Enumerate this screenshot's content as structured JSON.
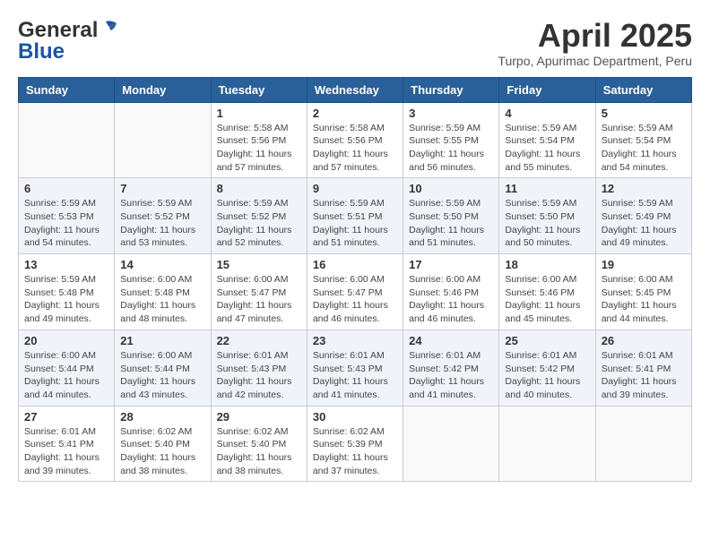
{
  "header": {
    "logo_line1": "General",
    "logo_line2": "Blue",
    "month": "April 2025",
    "location": "Turpo, Apurimac Department, Peru"
  },
  "weekdays": [
    "Sunday",
    "Monday",
    "Tuesday",
    "Wednesday",
    "Thursday",
    "Friday",
    "Saturday"
  ],
  "weeks": [
    [
      {
        "day": "",
        "info": ""
      },
      {
        "day": "",
        "info": ""
      },
      {
        "day": "1",
        "info": "Sunrise: 5:58 AM\nSunset: 5:56 PM\nDaylight: 11 hours and 57 minutes."
      },
      {
        "day": "2",
        "info": "Sunrise: 5:58 AM\nSunset: 5:56 PM\nDaylight: 11 hours and 57 minutes."
      },
      {
        "day": "3",
        "info": "Sunrise: 5:59 AM\nSunset: 5:55 PM\nDaylight: 11 hours and 56 minutes."
      },
      {
        "day": "4",
        "info": "Sunrise: 5:59 AM\nSunset: 5:54 PM\nDaylight: 11 hours and 55 minutes."
      },
      {
        "day": "5",
        "info": "Sunrise: 5:59 AM\nSunset: 5:54 PM\nDaylight: 11 hours and 54 minutes."
      }
    ],
    [
      {
        "day": "6",
        "info": "Sunrise: 5:59 AM\nSunset: 5:53 PM\nDaylight: 11 hours and 54 minutes."
      },
      {
        "day": "7",
        "info": "Sunrise: 5:59 AM\nSunset: 5:52 PM\nDaylight: 11 hours and 53 minutes."
      },
      {
        "day": "8",
        "info": "Sunrise: 5:59 AM\nSunset: 5:52 PM\nDaylight: 11 hours and 52 minutes."
      },
      {
        "day": "9",
        "info": "Sunrise: 5:59 AM\nSunset: 5:51 PM\nDaylight: 11 hours and 51 minutes."
      },
      {
        "day": "10",
        "info": "Sunrise: 5:59 AM\nSunset: 5:50 PM\nDaylight: 11 hours and 51 minutes."
      },
      {
        "day": "11",
        "info": "Sunrise: 5:59 AM\nSunset: 5:50 PM\nDaylight: 11 hours and 50 minutes."
      },
      {
        "day": "12",
        "info": "Sunrise: 5:59 AM\nSunset: 5:49 PM\nDaylight: 11 hours and 49 minutes."
      }
    ],
    [
      {
        "day": "13",
        "info": "Sunrise: 5:59 AM\nSunset: 5:48 PM\nDaylight: 11 hours and 49 minutes."
      },
      {
        "day": "14",
        "info": "Sunrise: 6:00 AM\nSunset: 5:48 PM\nDaylight: 11 hours and 48 minutes."
      },
      {
        "day": "15",
        "info": "Sunrise: 6:00 AM\nSunset: 5:47 PM\nDaylight: 11 hours and 47 minutes."
      },
      {
        "day": "16",
        "info": "Sunrise: 6:00 AM\nSunset: 5:47 PM\nDaylight: 11 hours and 46 minutes."
      },
      {
        "day": "17",
        "info": "Sunrise: 6:00 AM\nSunset: 5:46 PM\nDaylight: 11 hours and 46 minutes."
      },
      {
        "day": "18",
        "info": "Sunrise: 6:00 AM\nSunset: 5:46 PM\nDaylight: 11 hours and 45 minutes."
      },
      {
        "day": "19",
        "info": "Sunrise: 6:00 AM\nSunset: 5:45 PM\nDaylight: 11 hours and 44 minutes."
      }
    ],
    [
      {
        "day": "20",
        "info": "Sunrise: 6:00 AM\nSunset: 5:44 PM\nDaylight: 11 hours and 44 minutes."
      },
      {
        "day": "21",
        "info": "Sunrise: 6:00 AM\nSunset: 5:44 PM\nDaylight: 11 hours and 43 minutes."
      },
      {
        "day": "22",
        "info": "Sunrise: 6:01 AM\nSunset: 5:43 PM\nDaylight: 11 hours and 42 minutes."
      },
      {
        "day": "23",
        "info": "Sunrise: 6:01 AM\nSunset: 5:43 PM\nDaylight: 11 hours and 41 minutes."
      },
      {
        "day": "24",
        "info": "Sunrise: 6:01 AM\nSunset: 5:42 PM\nDaylight: 11 hours and 41 minutes."
      },
      {
        "day": "25",
        "info": "Sunrise: 6:01 AM\nSunset: 5:42 PM\nDaylight: 11 hours and 40 minutes."
      },
      {
        "day": "26",
        "info": "Sunrise: 6:01 AM\nSunset: 5:41 PM\nDaylight: 11 hours and 39 minutes."
      }
    ],
    [
      {
        "day": "27",
        "info": "Sunrise: 6:01 AM\nSunset: 5:41 PM\nDaylight: 11 hours and 39 minutes."
      },
      {
        "day": "28",
        "info": "Sunrise: 6:02 AM\nSunset: 5:40 PM\nDaylight: 11 hours and 38 minutes."
      },
      {
        "day": "29",
        "info": "Sunrise: 6:02 AM\nSunset: 5:40 PM\nDaylight: 11 hours and 38 minutes."
      },
      {
        "day": "30",
        "info": "Sunrise: 6:02 AM\nSunset: 5:39 PM\nDaylight: 11 hours and 37 minutes."
      },
      {
        "day": "",
        "info": ""
      },
      {
        "day": "",
        "info": ""
      },
      {
        "day": "",
        "info": ""
      }
    ]
  ]
}
